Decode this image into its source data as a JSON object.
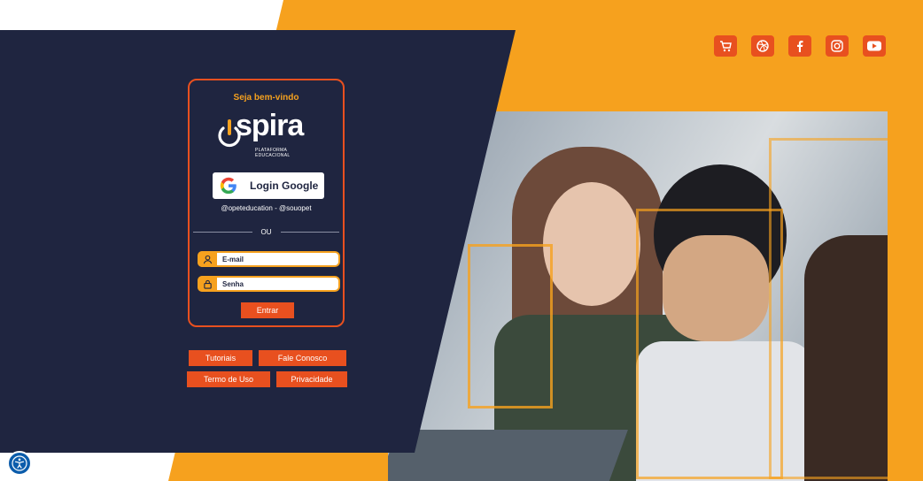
{
  "colors": {
    "navy": "#1f2540",
    "orange": "#f6a11e",
    "accent": "#e8501f"
  },
  "social": [
    {
      "name": "cart-icon"
    },
    {
      "name": "dribbble-icon"
    },
    {
      "name": "facebook-icon"
    },
    {
      "name": "instagram-icon"
    },
    {
      "name": "youtube-icon"
    }
  ],
  "card": {
    "welcome": "Seja bem-vindo",
    "logo_word": "spira",
    "logo_sub": "PLATAFORMA EDUCACIONAL",
    "google_label": "Login Google",
    "handles": "@opeteducation - @souopet",
    "or": "OU",
    "email_placeholder": "E-mail",
    "password_placeholder": "Senha",
    "submit": "Entrar"
  },
  "links": {
    "tutorials": "Tutoriais",
    "contact": "Fale Conosco",
    "terms": "Termo de Uso",
    "privacy": "Privacidade"
  }
}
